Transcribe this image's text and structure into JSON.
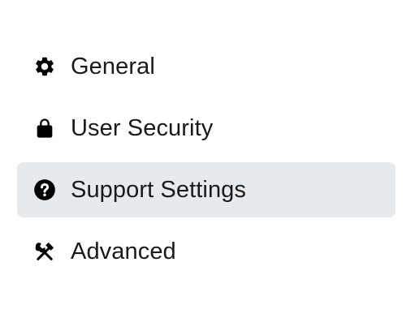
{
  "sidebar": {
    "items": [
      {
        "label": "General",
        "icon": "gear-icon",
        "active": false
      },
      {
        "label": "User Security",
        "icon": "lock-icon",
        "active": false
      },
      {
        "label": "Support Settings",
        "icon": "question-circle-icon",
        "active": true
      },
      {
        "label": "Advanced",
        "icon": "tools-icon",
        "active": false
      }
    ]
  },
  "colors": {
    "active_background": "#e7eaed",
    "text": "#1a1a1a",
    "icon": "#000000"
  }
}
